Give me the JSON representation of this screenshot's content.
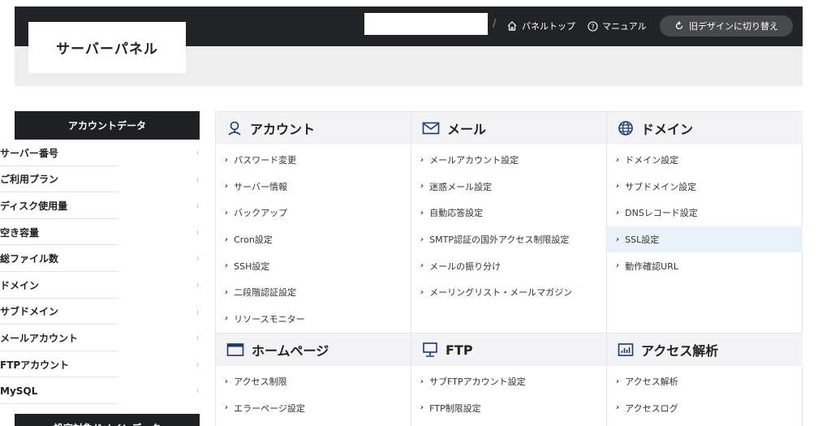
{
  "header": {
    "logo": "サーバーパネル",
    "server_input_value": "",
    "nav": [
      {
        "label": "パネルトップ",
        "icon": "home-icon"
      },
      {
        "label": "マニュアル",
        "icon": "help-circle-icon"
      }
    ],
    "switch_label": "旧デザインに切り替え",
    "switch_icon": "refresh-icon"
  },
  "sidebar": {
    "title": "アカウントデータ",
    "items": [
      "サーバー番号",
      "ご利用プラン",
      "ディスク使用量",
      "空き容量",
      "総ファイル数",
      "ドメイン",
      "サブドメイン",
      "メールアカウント",
      "FTPアカウント",
      "MySQL"
    ],
    "title2": "設定対象ドメインデータ"
  },
  "sections": {
    "account": {
      "title": "アカウント",
      "icon": "user-icon",
      "links": [
        "パスワード変更",
        "サーバー情報",
        "バックアップ",
        "Cron設定",
        "SSH設定",
        "二段階認証設定",
        "リソースモニター"
      ]
    },
    "mail": {
      "title": "メール",
      "icon": "envelope-icon",
      "links": [
        "メールアカウント設定",
        "迷惑メール設定",
        "自動応答設定",
        "SMTP認証の国外アクセス制限設定",
        "メールの振り分け",
        "メーリングリスト・メールマガジン"
      ]
    },
    "domain": {
      "title": "ドメイン",
      "icon": "globe-icon",
      "links": [
        "ドメイン設定",
        "サブドメイン設定",
        "DNSレコード設定",
        "SSL設定",
        "動作確認URL"
      ]
    },
    "homepage": {
      "title": "ホームページ",
      "icon": "browser-window-icon",
      "links": [
        "アクセス制限",
        "エラーページ設定"
      ]
    },
    "ftp": {
      "title": "FTP",
      "icon": "monitor-icon",
      "links": [
        "サブFTPアカウント設定",
        "FTP制限設定"
      ]
    },
    "analytics": {
      "title": "アクセス解析",
      "icon": "bar-chart-icon",
      "links": [
        "アクセス解析",
        "アクセスログ"
      ]
    }
  },
  "colors": {
    "accent": "#1a3a6e",
    "header_dark": "#222326",
    "active_row": "#e9f1fb"
  }
}
